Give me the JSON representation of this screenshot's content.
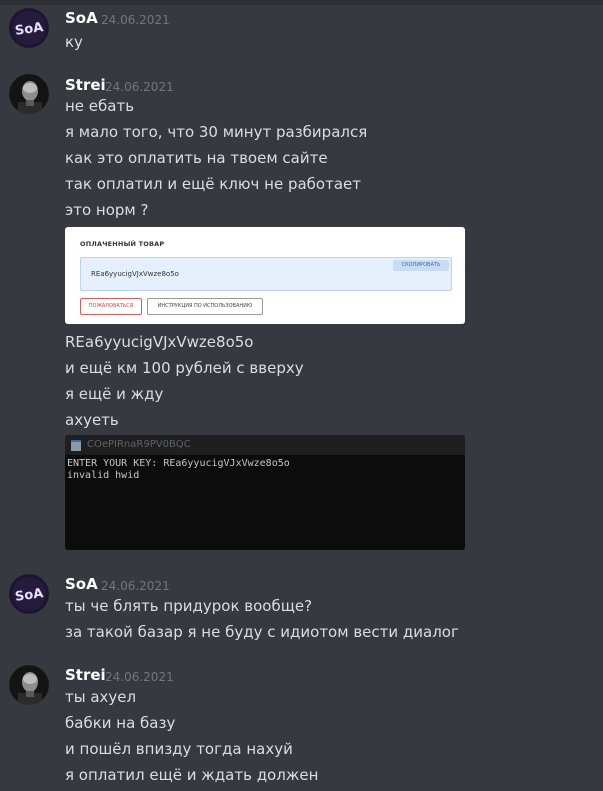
{
  "messages": [
    {
      "author": "SoA",
      "timestamp": "24.06.2021",
      "lines": [
        "ку"
      ]
    },
    {
      "author": "Strei",
      "timestamp": "24.06.2021",
      "lines": [
        "не ебать",
        "я мало того, что 30 минут разбирался",
        "как это оплатить на твоем сайте",
        "так оплатил и ещё ключ не работает",
        "это норм ?"
      ]
    },
    {
      "author": "Strei",
      "lines_after_embed": [
        "REa6yyucigVJxVwze8o5o",
        "и ещё км 100 рублей с вверху",
        "я ещё и жду",
        "ахуеть"
      ]
    },
    {
      "author": "SoA",
      "timestamp": "24.06.2021",
      "lines": [
        "ты че блять придурок вообще?",
        "за такой базар я не буду с идиотом вести диалог"
      ]
    },
    {
      "author": "Strei",
      "timestamp": "24.06.2021",
      "lines": [
        "ты ахуел",
        "бабки на базу",
        "и пошёл впизду тогда нахуй",
        "я оплатил ещё и ждать должен"
      ]
    }
  ],
  "purchase_embed": {
    "title": "ОПЛАЧЕННЫЙ ТОВАР",
    "key": "REa6yyucigVJxVwze8o5o",
    "copy_label": "СКОПИРОВАТЬ",
    "complain_label": "ПОЖАЛОВАТЬСЯ",
    "instructions_label": "ИНСТРУКЦИЯ ПО ИСПОЛЬЗОВАНИЮ"
  },
  "console_embed": {
    "window_title": "COePIRnaR9PV0BQC",
    "lines": [
      "ENTER YOUR KEY: REa6yyucigVJxVwze8o5o",
      "invalid hwid"
    ]
  },
  "colors": {
    "background": "#36393f",
    "author": "#ffffff",
    "text": "#dcddde",
    "timestamp": "#72767d"
  }
}
